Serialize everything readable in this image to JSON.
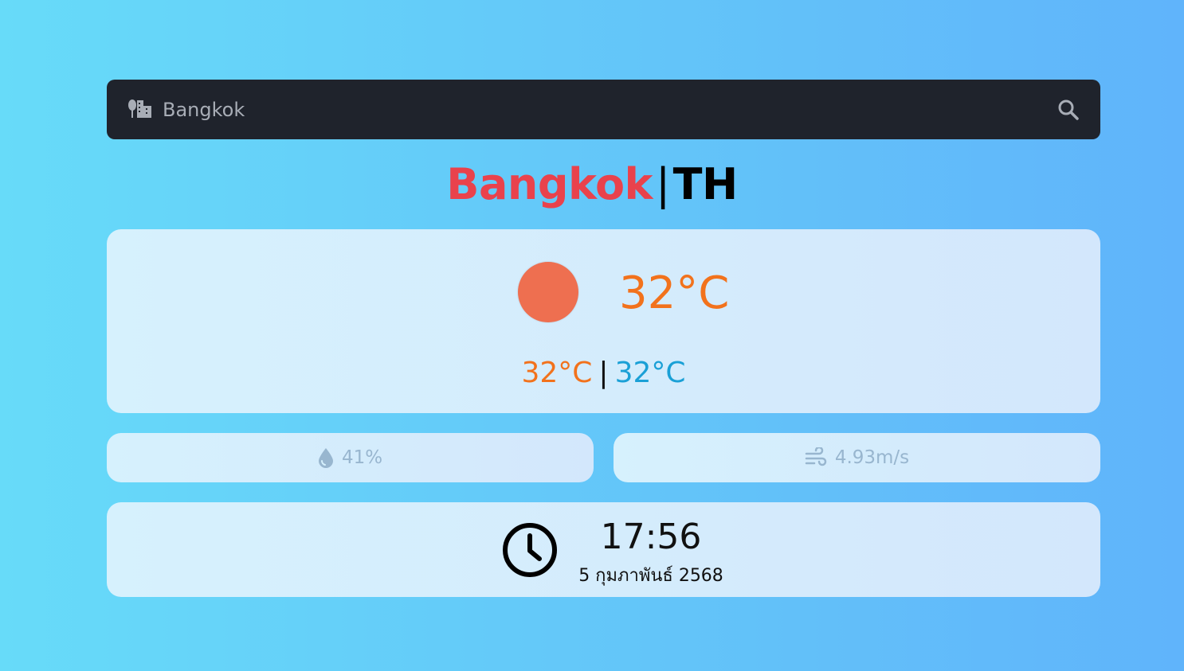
{
  "search": {
    "value": "Bangkok",
    "city_icon": "city-icon",
    "search_icon": "search-icon"
  },
  "location": {
    "city": "Bangkok",
    "separator": "|",
    "country": "TH"
  },
  "weather": {
    "condition_icon": "sun-icon",
    "temperature": "32°C",
    "temp_max": "32°C",
    "range_separator": "|",
    "temp_min": "32°C"
  },
  "humidity": {
    "icon": "droplet-icon",
    "value": "41%"
  },
  "wind": {
    "icon": "wind-icon",
    "value": "4.93m/s"
  },
  "clock": {
    "icon": "clock-icon",
    "time": "17:56",
    "date": "5 กุมภาพันธ์ 2568"
  },
  "colors": {
    "city_name": "#e9424c",
    "temp_warm": "#f2721c",
    "temp_cool": "#1aa0d6",
    "sun": "#ee6f50",
    "search_bg": "#1f232c"
  }
}
